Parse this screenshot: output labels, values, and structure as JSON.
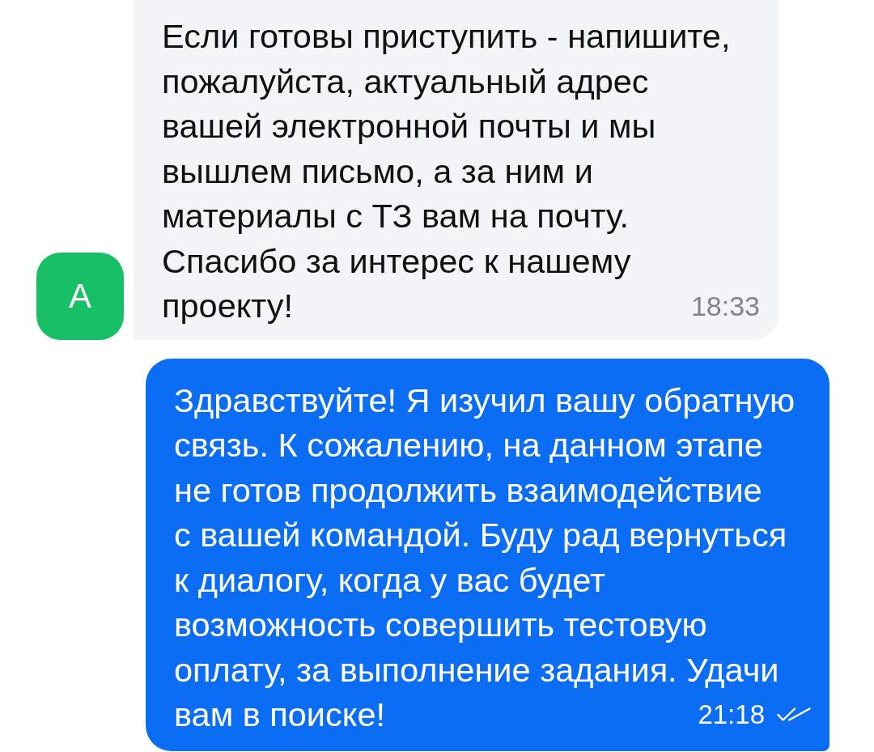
{
  "messages": [
    {
      "kind": "incoming",
      "sender_initial": "А",
      "lines": [
        "Если готовы приступить - напишите,",
        "пожалуйста, актуальный адрес",
        "вашей электронной почты и мы",
        "вышлем письмо, а за ним и",
        "материалы с ТЗ вам на почту.",
        "Спасибо за интерес к нашему",
        "проекту!"
      ],
      "time": "18:33"
    },
    {
      "kind": "outgoing",
      "lines": [
        "Здравствуйте! Я изучил вашу обратную",
        "связь. К сожалению, на данном этапе",
        "не готов продолжить взаимодействие",
        "с вашей командой. Буду рад вернуться",
        "к диалогу, когда у вас будет",
        "возможность совершить тестовую",
        "оплату, за выполнение задания. Удачи",
        "вам в поиске!"
      ],
      "time": "21:18",
      "read": true
    }
  ]
}
